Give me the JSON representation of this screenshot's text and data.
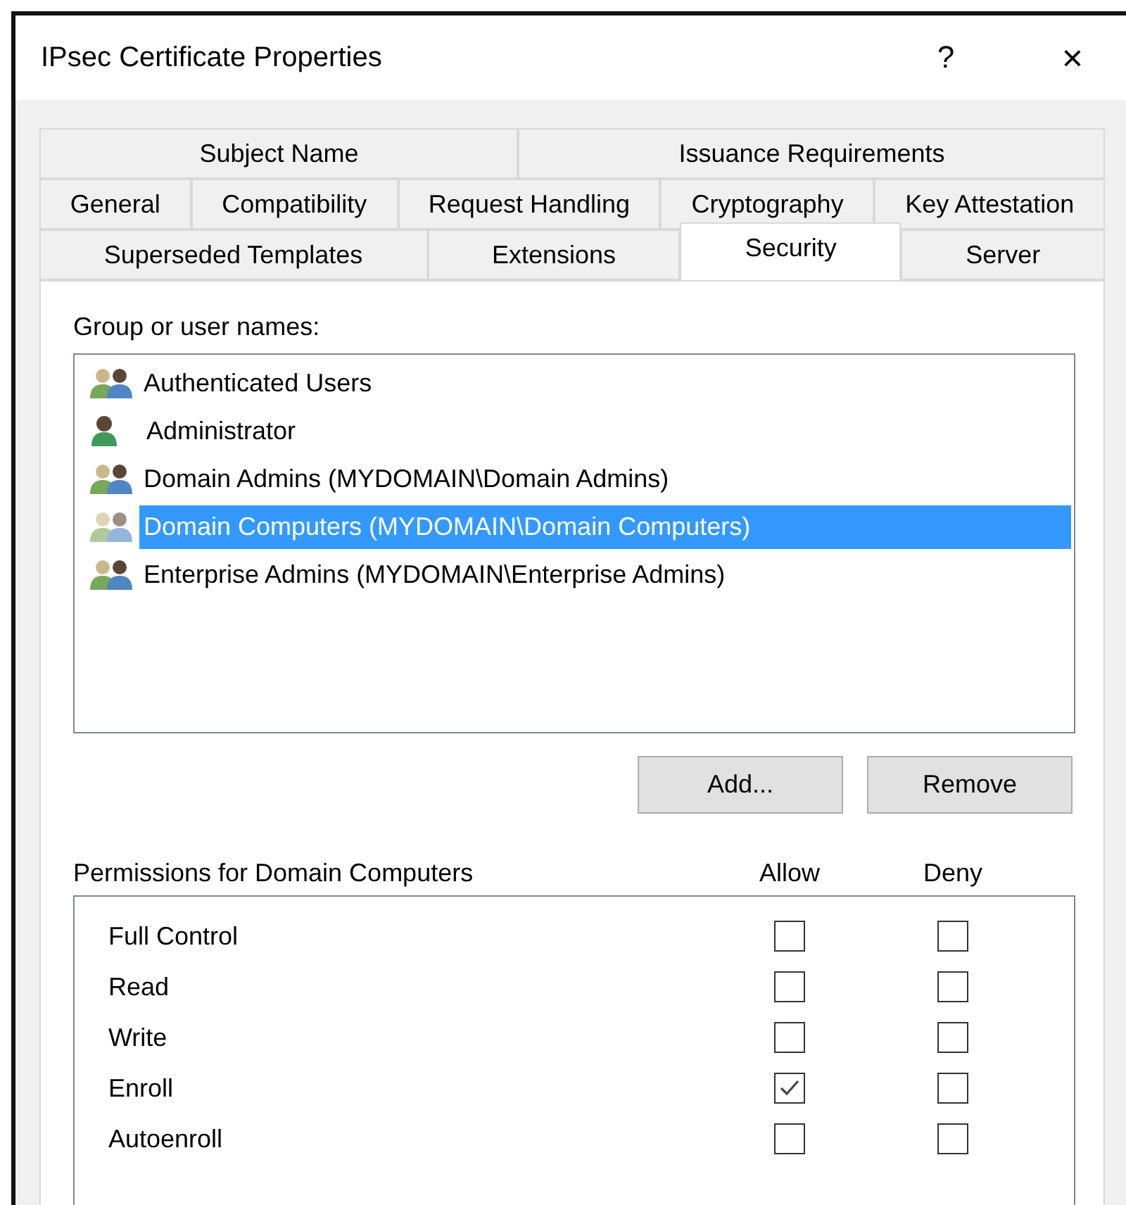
{
  "window": {
    "title": "IPsec Certificate Properties",
    "help": "?",
    "close": "×"
  },
  "tab_rows": [
    [
      {
        "label": "Subject Name",
        "selected": false
      },
      {
        "label": "Issuance Requirements",
        "selected": false
      }
    ],
    [
      {
        "label": "General",
        "selected": false
      },
      {
        "label": "Compatibility",
        "selected": false
      },
      {
        "label": "Request Handling",
        "selected": false
      },
      {
        "label": "Cryptography",
        "selected": false
      },
      {
        "label": "Key Attestation",
        "selected": false
      }
    ],
    [
      {
        "label": "Superseded Templates",
        "selected": false
      },
      {
        "label": "Extensions",
        "selected": false
      },
      {
        "label": "Security",
        "selected": true
      },
      {
        "label": "Server",
        "selected": false
      }
    ]
  ],
  "group_label": "Group or user names:",
  "members": [
    {
      "name": "Authenticated Users",
      "kind": "group",
      "selected": false
    },
    {
      "name": "Administrator",
      "kind": "user",
      "selected": false
    },
    {
      "name": "Domain Admins (MYDOMAIN\\Domain Admins)",
      "kind": "group",
      "selected": false
    },
    {
      "name": "Domain Computers (MYDOMAIN\\Domain Computers)",
      "kind": "group",
      "selected": true
    },
    {
      "name": "Enterprise Admins (MYDOMAIN\\Enterprise Admins)",
      "kind": "group",
      "selected": false
    }
  ],
  "buttons": [
    "Add...",
    "Remove"
  ],
  "permissions_label": "Permissions for Domain Computers",
  "columns": [
    "Allow",
    "Deny"
  ],
  "permissions": [
    {
      "name": "Full Control",
      "allow": false,
      "deny": false
    },
    {
      "name": "Read",
      "allow": false,
      "deny": false
    },
    {
      "name": "Write",
      "allow": false,
      "deny": false
    },
    {
      "name": "Enroll",
      "allow": true,
      "deny": false
    },
    {
      "name": "Autoenroll",
      "allow": false,
      "deny": false
    }
  ]
}
